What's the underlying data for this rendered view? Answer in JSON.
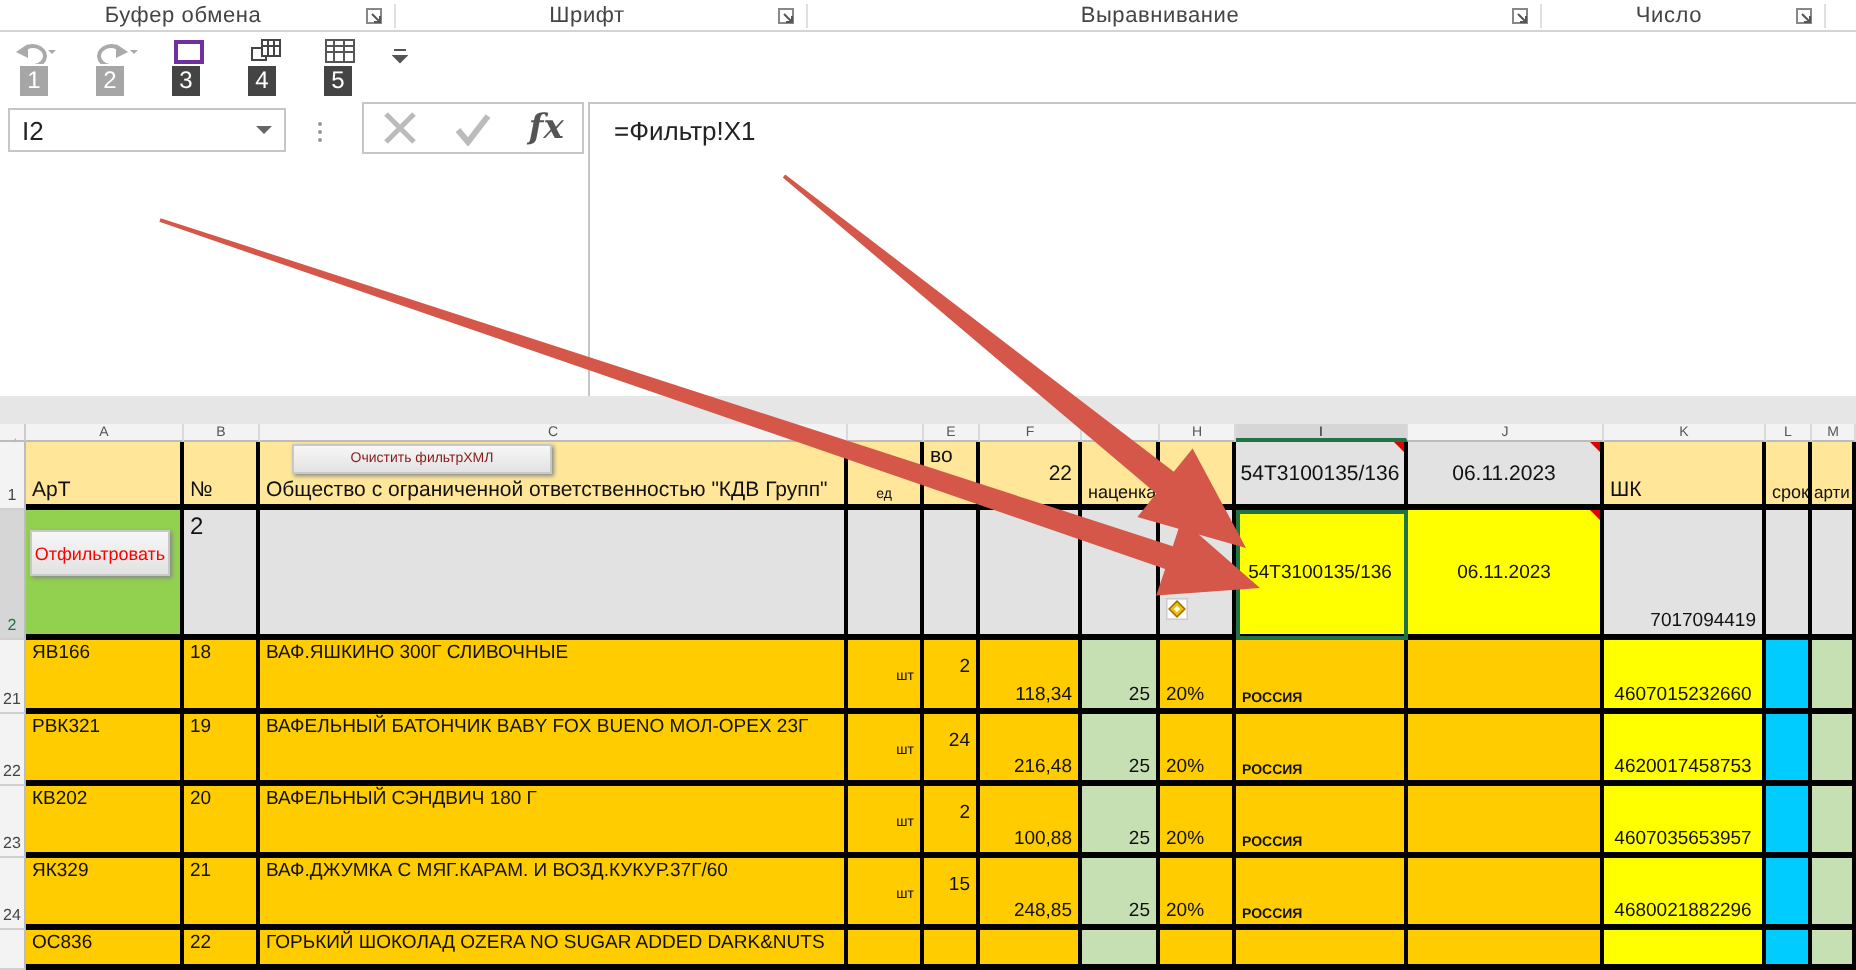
{
  "ribbon_groups": [
    {
      "label": "Буфер обмена"
    },
    {
      "label": "Шрифт"
    },
    {
      "label": "Выравнивание"
    },
    {
      "label": "Число"
    }
  ],
  "quick_access": [
    {
      "kind": "undo",
      "badge": "1",
      "disabled": true
    },
    {
      "kind": "redo",
      "badge": "2",
      "disabled": true
    },
    {
      "kind": "save",
      "badge": "3",
      "disabled": false
    },
    {
      "kind": "table",
      "badge": "4",
      "disabled": false
    },
    {
      "kind": "grid",
      "badge": "5",
      "disabled": false
    }
  ],
  "formula_bar": {
    "name_box": "I2",
    "buttons": [
      {
        "kind": "cancel"
      },
      {
        "kind": "enter"
      },
      {
        "kind": "function",
        "label": "fx"
      }
    ],
    "formula": "=Фильтр!X1"
  },
  "columns": [
    {
      "label": "A",
      "selected": false
    },
    {
      "label": "B",
      "selected": false
    },
    {
      "label": "C",
      "selected": false
    },
    {
      "selected": false
    },
    {
      "label": "E",
      "selected": false
    },
    {
      "label": "F",
      "selected": false
    },
    {
      "selected": false
    },
    {
      "label": "H",
      "selected": false
    },
    {
      "label": "I",
      "selected": true
    },
    {
      "label": "J",
      "selected": false
    },
    {
      "label": "K",
      "selected": false
    },
    {
      "label": "L",
      "selected": false
    },
    {
      "label": "M",
      "selected": false
    }
  ],
  "rows": [
    {
      "kind": "header",
      "number": "1",
      "selected": false,
      "cells": [
        {
          "text": "АрТ"
        },
        {
          "text": "№"
        },
        {
          "text": "Общество с ограниченной ответственностью \"КДВ Групп\"",
          "button": "Очистить фильтрХМЛ"
        },
        {
          "text": "ед"
        },
        {
          "text": "во"
        },
        {
          "text": "22"
        },
        {
          "text": "наценка"
        },
        null,
        {
          "text": "54Т3100135/136",
          "comment": true
        },
        {
          "text": "06.11.2023",
          "comment": true
        },
        {
          "text": "ШК"
        },
        {
          "text": "срок"
        },
        {
          "text": "арти"
        }
      ]
    },
    {
      "kind": "filter",
      "number": "2",
      "selected": true,
      "cells": [
        {
          "button": "Отфильтровать"
        },
        {
          "text": "2"
        },
        null,
        null,
        null,
        null,
        null,
        {
          "paste_options": true
        },
        {
          "text": "54Т3100135/136"
        },
        {
          "text": "06.11.2023",
          "comment": true
        },
        {
          "text": "7017094419"
        },
        null,
        null
      ]
    },
    {
      "kind": "item",
      "number": "21",
      "selected": false,
      "cells": [
        {
          "text": "ЯВ166"
        },
        {
          "text": "18"
        },
        {
          "text": "ВАФ.ЯШКИНО 300Г СЛИВОЧНЫЕ"
        },
        {
          "text": "шт"
        },
        {
          "text": "2"
        },
        {
          "text": "118,34"
        },
        {
          "text": "25"
        },
        {
          "text": "20%"
        },
        {
          "text": "РОССИЯ"
        },
        null,
        {
          "text": "4607015232660"
        },
        null,
        null
      ]
    },
    {
      "kind": "item",
      "number": "22",
      "selected": false,
      "cells": [
        {
          "text": "РВК321"
        },
        {
          "text": "19"
        },
        {
          "text": "ВАФЕЛЬНЫЙ БАТОНЧИК BABY FOX BUENO МОЛ-ОРЕХ 23Г"
        },
        {
          "text": "шт"
        },
        {
          "text": "24"
        },
        {
          "text": "216,48"
        },
        {
          "text": "25"
        },
        {
          "text": "20%"
        },
        {
          "text": "РОССИЯ"
        },
        null,
        {
          "text": "4620017458753"
        },
        null,
        null
      ]
    },
    {
      "kind": "item",
      "number": "23",
      "selected": false,
      "cells": [
        {
          "text": "КВ202"
        },
        {
          "text": "20"
        },
        {
          "text": "ВАФЕЛЬНЫЙ СЭНДВИЧ 180 Г"
        },
        {
          "text": "шт"
        },
        {
          "text": "2"
        },
        {
          "text": "100,88"
        },
        {
          "text": "25"
        },
        {
          "text": "20%"
        },
        {
          "text": "РОССИЯ"
        },
        null,
        {
          "text": "4607035653957"
        },
        null,
        null
      ]
    },
    {
      "kind": "item",
      "number": "24",
      "selected": false,
      "cells": [
        {
          "text": "ЯК329"
        },
        {
          "text": "21"
        },
        {
          "text": "ВАФ.ДЖУМКА С МЯГ.КАРАМ. И ВОЗД.КУКУР.37Г/60"
        },
        {
          "text": "шт"
        },
        {
          "text": "15"
        },
        {
          "text": "248,85"
        },
        {
          "text": "25"
        },
        {
          "text": "20%"
        },
        {
          "text": "РОССИЯ"
        },
        null,
        {
          "text": "4680021882296"
        },
        null,
        null
      ]
    },
    {
      "kind": "item",
      "selected": false,
      "cells": [
        {
          "text": "ОС836"
        },
        {
          "text": "22"
        },
        {
          "text": "ГОРЬКИЙ ШОКОЛАД OZERA NO SUGAR ADDED DARK&NUTS"
        },
        null,
        null,
        null,
        null,
        null,
        null,
        null,
        null,
        null,
        null
      ]
    }
  ],
  "annotations": [
    {
      "kind": "arrow"
    },
    {
      "kind": "arrow"
    }
  ]
}
